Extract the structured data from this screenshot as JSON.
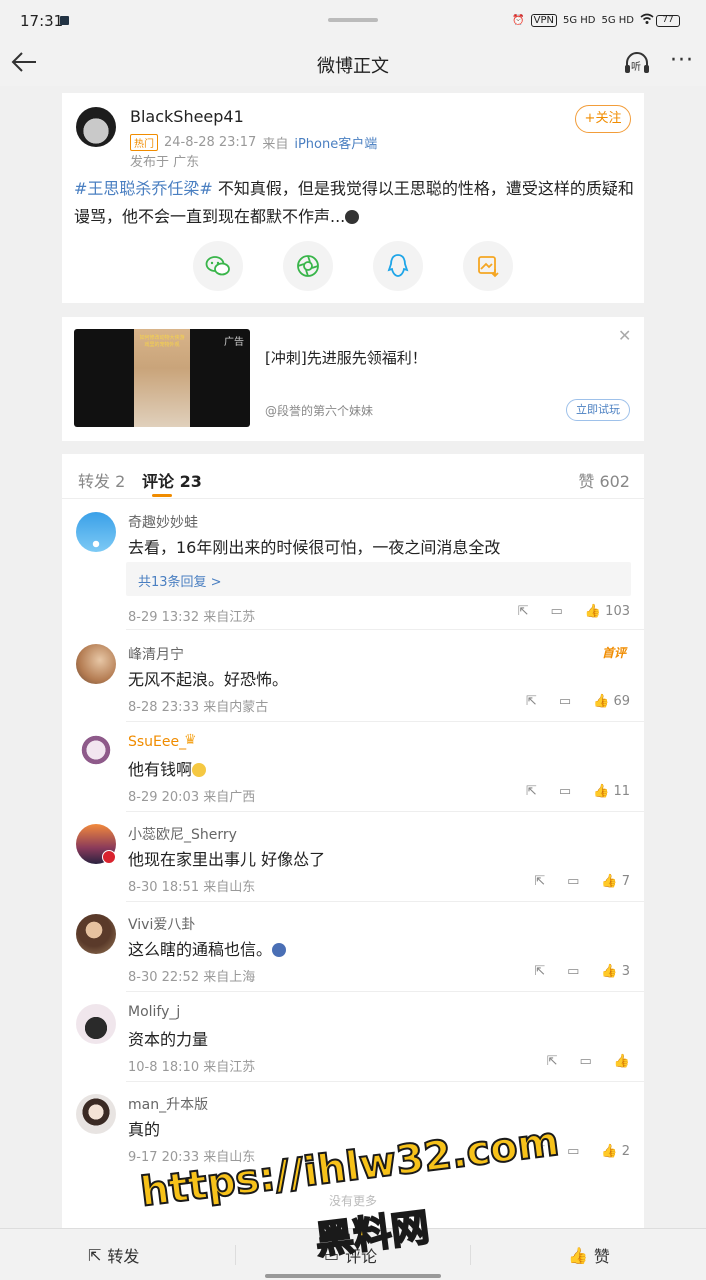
{
  "status": {
    "time": "17:31",
    "vpn": "VPN",
    "net1": "5G HD",
    "net2": "5G HD",
    "battery": "77"
  },
  "nav": {
    "title": "微博正文",
    "listen_label": "听"
  },
  "post": {
    "author": "BlackSheep41",
    "hot_badge": "热门",
    "datetime": "24-8-28 23:17",
    "source_prefix": "来自",
    "source": "iPhone客户端",
    "location": "发布于 广东",
    "follow_label": "+关注",
    "hashtag": "#王思聪杀乔任梁#",
    "text": " 不知真假，但是我觉得以王思聪的性格，遭受这样的质疑和谩骂，他不会一直到现在都默不作声..."
  },
  "ad": {
    "badge": "广告",
    "title": "[冲刺]先进服先领福利！",
    "account": "@段誉的第六个妹妹",
    "cta": "立即试玩",
    "thumb_caption_1": "如何修改动物大侠游",
    "thumb_caption_2": "戏里的宠物外观"
  },
  "tabs": {
    "repost": "转发 2",
    "comments": "评论 23",
    "likes": "赞 602"
  },
  "comments": [
    {
      "name": "奇趣妙妙蛙",
      "text": "去看，16年刚出来的时候很可怕，一夜之间消息全改",
      "replies": "共13条回复 >",
      "meta": "8-29 13:32  来自江苏",
      "likes": "103"
    },
    {
      "name": "峰清月宁",
      "badge": "首评",
      "text": "无风不起浪。好恐怖。",
      "meta": "8-28 23:33  来自内蒙古",
      "likes": "69"
    },
    {
      "name": "SsuEee_",
      "text": "他有钱啊",
      "meta": "8-29 20:03  来自广西",
      "likes": "11"
    },
    {
      "name": "小蕊欧尼_Sherry",
      "text": "他现在家里出事儿 好像怂了",
      "meta": "8-30 18:51  来自山东",
      "likes": "7"
    },
    {
      "name": "Vivi爱八卦",
      "text": "这么瞎的通稿也信。",
      "meta": "8-30 22:52  来自上海",
      "likes": "3"
    },
    {
      "name": "Molify_j",
      "text": "资本的力量",
      "meta": "10-8 18:10  来自江苏",
      "likes": ""
    },
    {
      "name": "man_升本版",
      "text": "真的",
      "meta": "9-17 20:33  来自山东",
      "likes": "2"
    }
  ],
  "footer_hint": "没有更多",
  "bottom_bar": {
    "repost": "转发",
    "comment": "评论",
    "like": "赞"
  },
  "watermark": {
    "url": "https://ihlw32.com",
    "name": "黑料网"
  }
}
